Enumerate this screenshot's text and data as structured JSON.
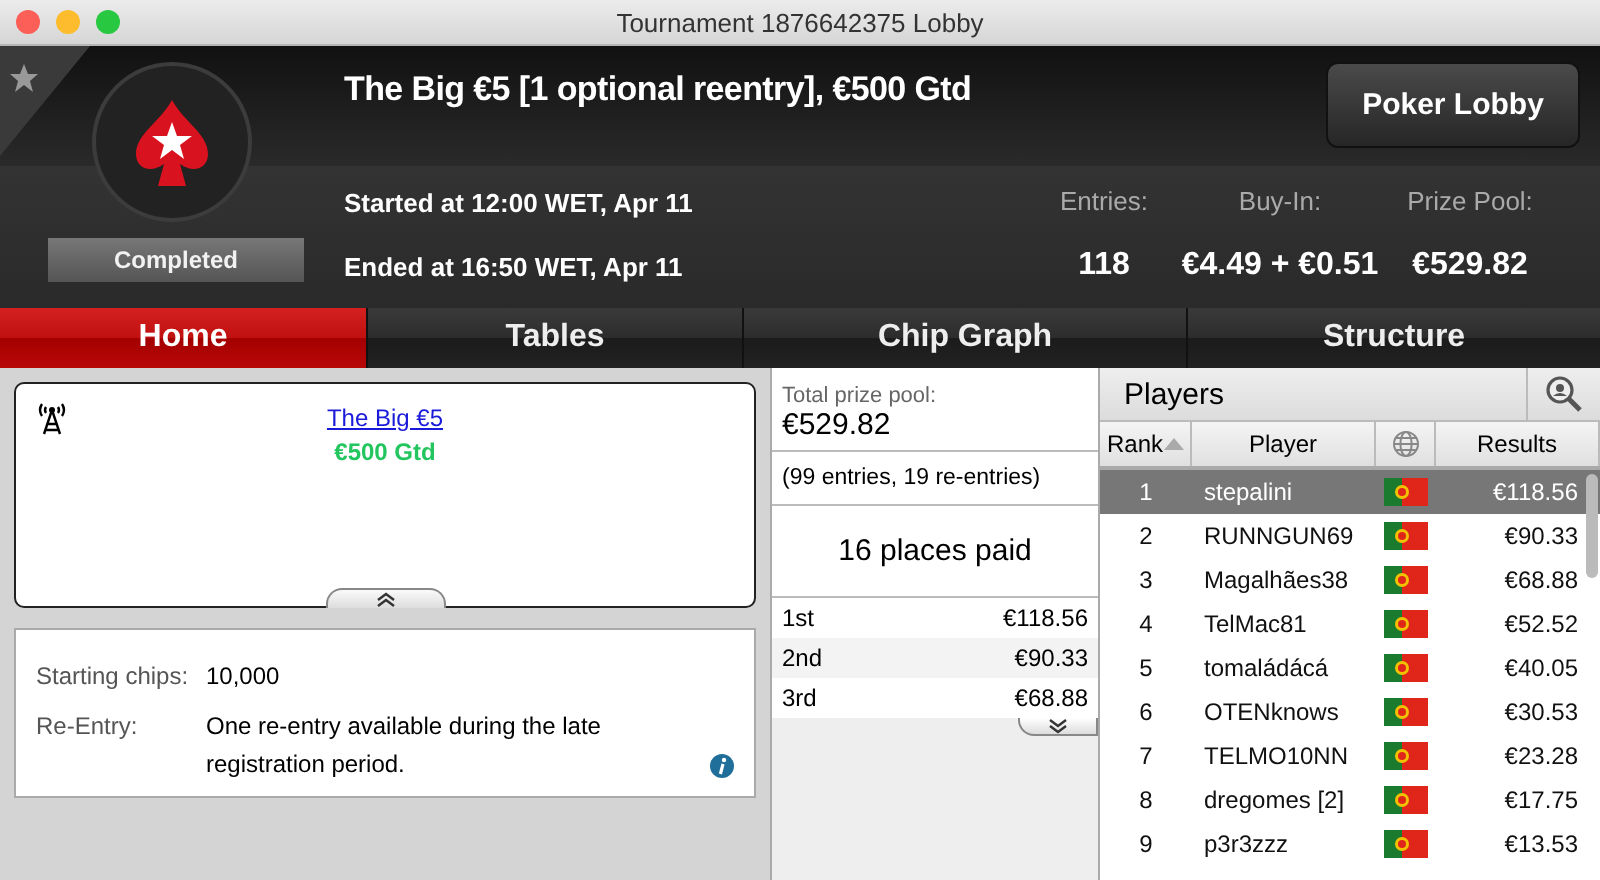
{
  "window": {
    "title": "Tournament 1876642375 Lobby"
  },
  "header": {
    "title": "The Big €5 [1 optional reentry], €500 Gtd",
    "status": "Completed",
    "favorite": false,
    "started": "Started at 12:00 WET, Apr 11",
    "ended": "Ended at 16:50 WET, Apr 11",
    "button": "Poker Lobby",
    "stats": [
      {
        "label": "Entries:",
        "value": "118"
      },
      {
        "label": "Buy-In:",
        "value": "€4.49 + €0.51"
      },
      {
        "label": "Prize Pool:",
        "value": "€529.82"
      }
    ]
  },
  "tabs": [
    {
      "label": "Home",
      "selected": true
    },
    {
      "label": "Tables",
      "selected": false
    },
    {
      "label": "Chip Graph",
      "selected": false
    },
    {
      "label": "Structure",
      "selected": false
    }
  ],
  "summary": {
    "link": "The Big €5",
    "guarantee": "€500 Gtd"
  },
  "details": [
    {
      "label": "Starting chips:",
      "value": "10,000",
      "info": false
    },
    {
      "label": "Re-Entry:",
      "value": "One re-entry available during the late registration period.",
      "info": true
    }
  ],
  "prizes": {
    "label": "Total prize pool:",
    "total": "€529.82",
    "entries": "(99 entries, 19 re-entries)",
    "paid": "16 places paid",
    "places": [
      {
        "place": "1st",
        "amount": "€118.56"
      },
      {
        "place": "2nd",
        "amount": "€90.33"
      },
      {
        "place": "3rd",
        "amount": "€68.88"
      }
    ]
  },
  "players": {
    "title": "Players",
    "columns": [
      "Rank",
      "Player",
      "Results"
    ],
    "rows": [
      {
        "rank": "1",
        "name": "stepalini",
        "result": "€118.56",
        "selected": true
      },
      {
        "rank": "2",
        "name": "RUNNGUN69",
        "result": "€90.33",
        "selected": false
      },
      {
        "rank": "3",
        "name": "Magalhães38",
        "result": "€68.88",
        "selected": false
      },
      {
        "rank": "4",
        "name": "TelMac81",
        "result": "€52.52",
        "selected": false
      },
      {
        "rank": "5",
        "name": "tomaládácá",
        "result": "€40.05",
        "selected": false
      },
      {
        "rank": "6",
        "name": "OTENknows",
        "result": "€30.53",
        "selected": false
      },
      {
        "rank": "7",
        "name": "TELMO10NN",
        "result": "€23.28",
        "selected": false
      },
      {
        "rank": "8",
        "name": "dregomes [2]",
        "result": "€17.75",
        "selected": false
      },
      {
        "rank": "9",
        "name": "p3r3zzz",
        "result": "€13.53",
        "selected": false
      }
    ]
  }
}
